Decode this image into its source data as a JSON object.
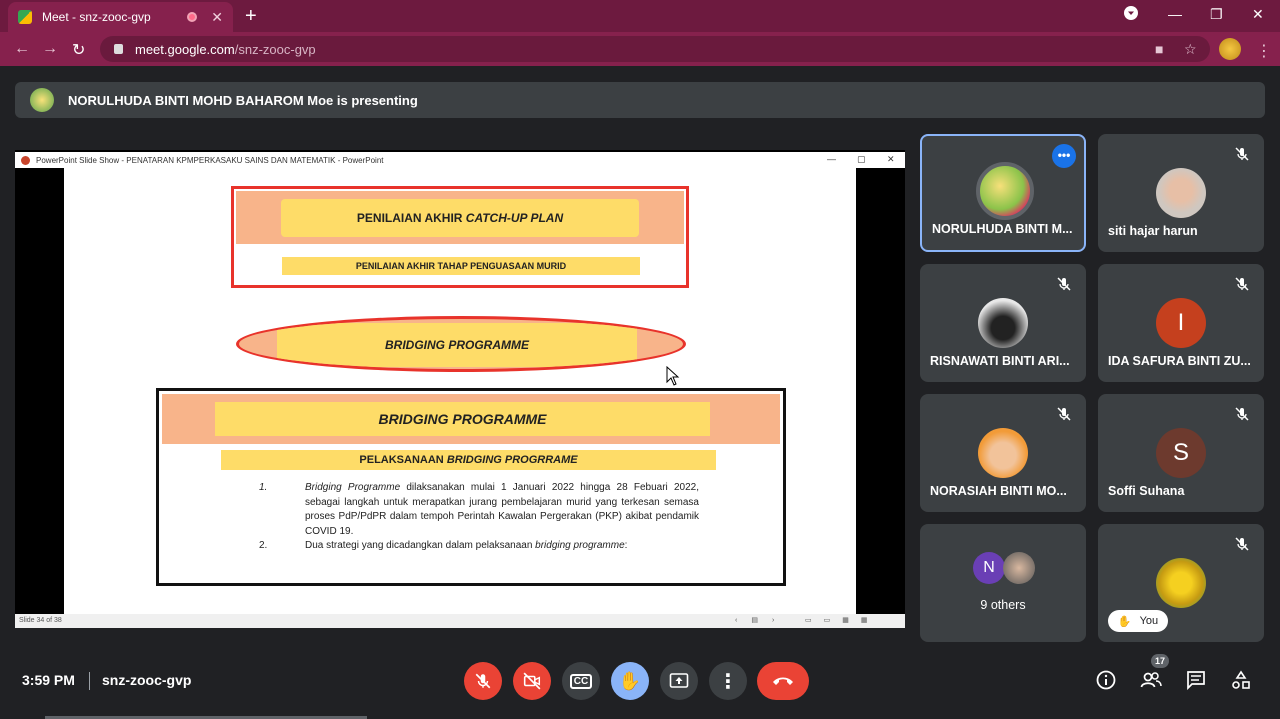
{
  "browser": {
    "tab_title": "Meet - snz-zooc-gvp",
    "url_host": "meet.google.com",
    "url_path": "/snz-zooc-gvp"
  },
  "presenting": {
    "text": "NORULHUDA BINTI MOHD BAHAROM Moe is presenting"
  },
  "ppt": {
    "window_title": "PowerPoint Slide Show  -  PENATARAN KPMPERKASAKU SAINS DAN MATEMATIK - PowerPoint",
    "status": "Slide 34 of 38"
  },
  "slide": {
    "box1_title_pre": "PENILAIAN AKHIR ",
    "box1_title_italic": "CATCH-UP PLAN",
    "box1_sub": "PENILAIAN AKHIR TAHAP PENGUASAAN MURID",
    "ellipse_label": "BRIDGING PROGRAMME",
    "box3_title": "BRIDGING PROGRAMME",
    "box3_sub_pre": "PELAKSANAAN ",
    "box3_sub_italic": "BRIDGING PROGRRAME",
    "item1_num": "1.",
    "item1_italic": "Bridging Programme",
    "item1_text": " dilaksanakan mulai 1 Januari 2022 hingga 28 Febuari 2022, sebagai langkah untuk merapatkan jurang pembelajaran murid yang terkesan semasa proses PdP/PdPR dalam tempoh Perintah Kawalan Pergerakan (PKP) akibat pendamik COVID 19.",
    "item2_num": "2.",
    "item2_text": "Dua strategi yang dicadangkan dalam pelaksanaan ",
    "item2_italic": "bridging programme",
    "item2_end": ":"
  },
  "participants": [
    {
      "name": "NORULHUDA BINTI M...",
      "active": true
    },
    {
      "name": "siti hajar harun"
    },
    {
      "name": "RISNAWATI BINTI ARI..."
    },
    {
      "name": "IDA SAFURA BINTI ZU...",
      "initial": "I",
      "color": "#c5401e"
    },
    {
      "name": "NORASIAH BINTI MO..."
    },
    {
      "name": "Soffi Suhana",
      "initial": "S",
      "color": "#6d3a2e"
    }
  ],
  "others": {
    "label": "9 others",
    "initial": "N",
    "color": "#6a3fb5"
  },
  "you": {
    "label": "You"
  },
  "bottom": {
    "time": "3:59 PM",
    "meeting_code": "snz-zooc-gvp",
    "people_count": "17"
  }
}
